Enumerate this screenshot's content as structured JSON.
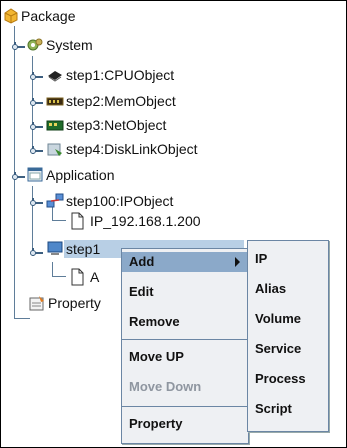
{
  "tree": {
    "root": "Package",
    "system": "System",
    "cpu": "step1:CPUObject",
    "mem": "step2:MemObject",
    "net": "step3:NetObject",
    "disk": "step4:DiskLinkObject",
    "application": "Application",
    "ip": "step100:IPObject",
    "ip_child": "IP_192.168.1.200",
    "selected_partial": "step1",
    "selected_tail": "A",
    "property": "Property"
  },
  "context_menu": {
    "items": [
      "Add",
      "Edit",
      "Remove",
      "Move UP",
      "Move Down",
      "Property"
    ],
    "disabled": [
      "Move Down"
    ],
    "active": "Add"
  },
  "submenu": {
    "items": [
      "IP",
      "Alias",
      "Volume",
      "Service",
      "Process",
      "Script"
    ]
  },
  "colors": {
    "selection": "#b8cfe5",
    "menu_bg": "#eef0f3",
    "menu_active": "#8ba9c9",
    "menu_border": "#6b86a4"
  }
}
